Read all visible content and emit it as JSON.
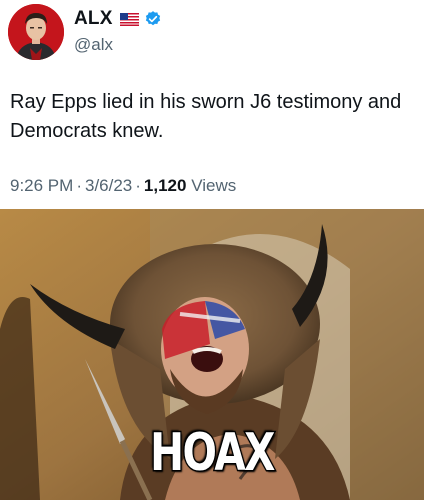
{
  "author": {
    "display_name": "ALX",
    "handle": "@alx",
    "flag_icon": "us-flag-icon",
    "verified_icon": "verified-badge-icon",
    "verified_color": "#1d9bf0"
  },
  "tweet": {
    "text": "Ray Epps lied in his sworn J6 testimony and Democrats knew.",
    "time": "9:26 PM",
    "date": "3/6/23",
    "separator": "·",
    "views_count": "1,120",
    "views_label": "Views"
  },
  "media": {
    "caption": "HOAX"
  }
}
